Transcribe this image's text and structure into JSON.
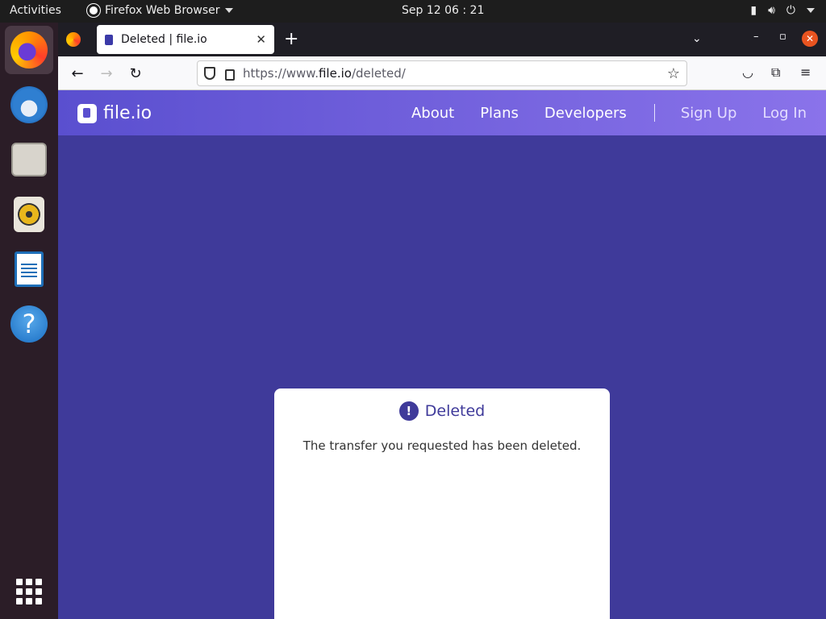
{
  "system": {
    "activities": "Activities",
    "app_name": "Firefox Web Browser",
    "clock": "Sep 12  06 : 21"
  },
  "dock": {
    "items": [
      {
        "name": "firefox",
        "icon": "firefox-icon",
        "active": true
      },
      {
        "name": "thunderbird",
        "icon": "thunderbird-icon"
      },
      {
        "name": "files",
        "icon": "files-icon"
      },
      {
        "name": "rhythmbox",
        "icon": "rhythmbox-icon"
      },
      {
        "name": "libreoffice-writer",
        "icon": "writer-icon"
      },
      {
        "name": "help",
        "icon": "help-icon",
        "glyph": "?"
      }
    ]
  },
  "browser": {
    "tab_title": "Deleted | file.io",
    "tab_close": "✕",
    "new_tab": "+",
    "url_prefix": "https://www.",
    "url_domain": "file.io",
    "url_path": "/deleted/"
  },
  "site": {
    "logo_text": "file.io",
    "nav": {
      "about": "About",
      "plans": "Plans",
      "developers": "Developers",
      "sign_up": "Sign Up",
      "log_in": "Log In"
    }
  },
  "card": {
    "alert_glyph": "!",
    "title": "Deleted",
    "message": "The transfer you requested has been deleted."
  },
  "colors": {
    "page_bg": "#3f3a9a",
    "header_start": "#5a4fcf",
    "header_end": "#8a73ea",
    "close_button": "#e95420"
  }
}
